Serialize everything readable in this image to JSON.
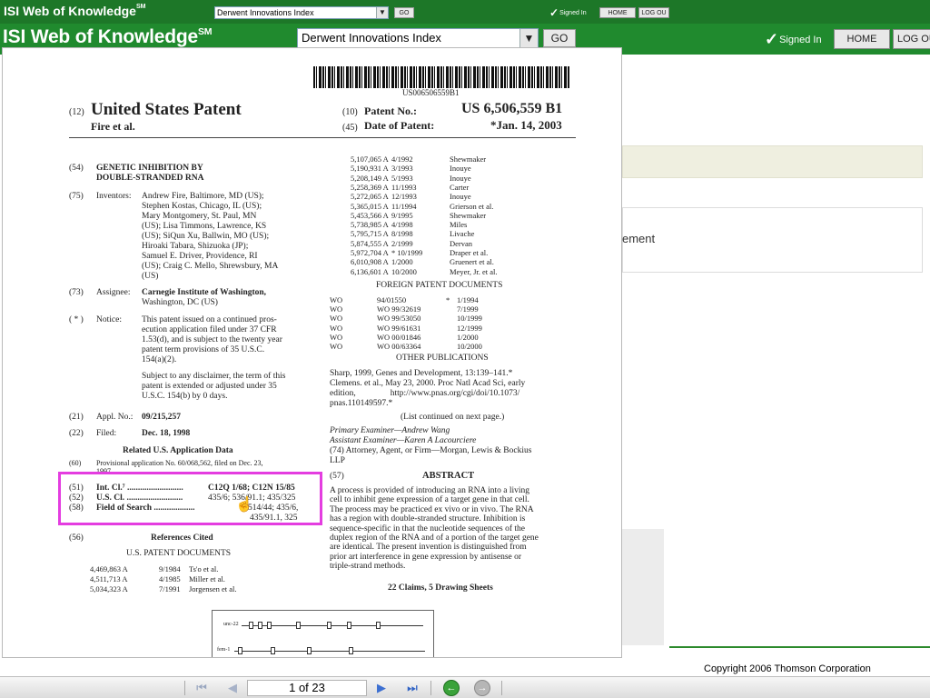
{
  "colors": {
    "brand_green": "#208a2e",
    "highlight": "#e43de0"
  },
  "header_small": {
    "brand": "ISI Web of Knowledge",
    "brand_mark": "SM",
    "database": "Derwent Innovations Index",
    "go": "GO",
    "signed_in": "Signed In",
    "home": "HOME",
    "logout": "LOG OU"
  },
  "header": {
    "brand": "ISI Web of Knowledge",
    "brand_mark": "SM",
    "database": "Derwent Innovations Index",
    "go": "GO",
    "signed_in": "Signed In",
    "home": "HOME",
    "logout": "LOG OU"
  },
  "background": {
    "partial_word": "ement",
    "copyright": "Copyright 2006 Thomson Corporation"
  },
  "patent": {
    "number_small": "US006506559B1",
    "code12": "(12)",
    "title": "United States Patent",
    "inventor_short": "Fire et al.",
    "code10": "(10)",
    "patent_no_label": "Patent No.:",
    "patent_no": "US 6,506,559 B1",
    "code45": "(45)",
    "date_label": "Date of Patent:",
    "date": "*Jan. 14, 2003",
    "code54": "(54)",
    "invention_title_1": "GENETIC INHIBITION BY",
    "invention_title_2": "DOUBLE-STRANDED RNA",
    "code75": "(75)",
    "inventors_label": "Inventors:",
    "inventors_lines": [
      "Andrew Fire, Baltimore, MD (US);",
      "Stephen Kostas, Chicago, IL (US);",
      "Mary Montgomery, St. Paul, MN",
      "(US); Lisa Timmons, Lawrence, KS",
      "(US); SiQun Xu, Ballwin, MO (US);",
      "Hiroaki Tabara, Shizuoka (JP);",
      "Samuel E. Driver, Providence, RI",
      "(US); Craig C. Mello, Shrewsbury, MA",
      "(US)"
    ],
    "code73": "(73)",
    "assignee_label": "Assignee:",
    "assignee_lines": [
      "Carnegie Institute of Washington,",
      "Washington, DC (US)"
    ],
    "code_notice": "( * )",
    "notice_label": "Notice:",
    "notice_lines": [
      "This patent issued on a continued pros-",
      "ecution application filed under 37 CFR",
      "1.53(d), and is subject to the twenty year",
      "patent term provisions of 35 U.S.C.",
      "154(a)(2)."
    ],
    "disclaimer_lines": [
      "Subject to any disclaimer, the term of this",
      "patent is extended or adjusted under 35",
      "U.S.C. 154(b) by 0 days."
    ],
    "code21": "(21)",
    "appl_label": "Appl. No.:",
    "appl_no": "09/215,257",
    "code22": "(22)",
    "filed_label": "Filed:",
    "filed": "Dec. 18, 1998",
    "related_heading": "Related U.S. Application Data",
    "code60": "(60)",
    "provisional_1": "Provisional application No. 60/068,562, filed on Dec. 23,",
    "provisional_2": "1997.",
    "class_rows": [
      {
        "code": "(51)",
        "label": "Int. Cl.⁷ ..........................",
        "value": "C12Q 1/68; C12N 15/85"
      },
      {
        "code": "(52)",
        "label": "U.S. Cl. ..........................",
        "value": "435/6; 536/91.1; 435/325"
      },
      {
        "code": "(58)",
        "label": "Field of Search ...................",
        "value": "514/44; 435/6,"
      }
    ],
    "class_cont": "435/91.1, 325",
    "code56": "(56)",
    "refs_heading": "References Cited",
    "us_docs_heading": "U.S. PATENT DOCUMENTS",
    "us_refs_left": [
      [
        "4,469,863 A",
        "9/1984",
        "Ts'o et al."
      ],
      [
        "4,511,713 A",
        "4/1985",
        "Miller et al."
      ],
      [
        "5,034,323 A",
        "7/1991",
        "Jorgensen et al."
      ]
    ],
    "us_refs_right": [
      [
        "5,107,065 A",
        "4/1992",
        "Shewmaker"
      ],
      [
        "5,190,931 A",
        "3/1993",
        "Inouye"
      ],
      [
        "5,208,149 A",
        "5/1993",
        "Inouye"
      ],
      [
        "5,258,369 A",
        "11/1993",
        "Carter"
      ],
      [
        "5,272,065 A",
        "12/1993",
        "Inouye"
      ],
      [
        "5,365,015 A",
        "11/1994",
        "Grierson et al."
      ],
      [
        "5,453,566 A",
        "9/1995",
        "Shewmaker"
      ],
      [
        "5,738,985 A",
        "4/1998",
        "Miles"
      ],
      [
        "5,795,715 A",
        "8/1998",
        "Livache"
      ],
      [
        "5,874,555 A",
        "2/1999",
        "Dervan"
      ],
      [
        "5,972,704 A",
        "* 10/1999",
        "Draper et al."
      ],
      [
        "6,010,908 A",
        "1/2000",
        "Gruenert et al."
      ],
      [
        "6,136,601 A",
        "10/2000",
        "Meyer, Jr. et al."
      ]
    ],
    "foreign_heading": "FOREIGN PATENT DOCUMENTS",
    "foreign_refs": [
      [
        "WO",
        "94/01550",
        "*",
        "1/1994"
      ],
      [
        "WO",
        "WO 99/32619",
        "",
        "7/1999"
      ],
      [
        "WO",
        "WO 99/53050",
        "",
        "10/1999"
      ],
      [
        "WO",
        "WO 99/61631",
        "",
        "12/1999"
      ],
      [
        "WO",
        "WO 00/01846",
        "",
        "1/2000"
      ],
      [
        "WO",
        "WO 00/63364",
        "",
        "10/2000"
      ]
    ],
    "other_heading": "OTHER PUBLICATIONS",
    "other_lines": [
      "Sharp, 1999, Genes and Development, 13:139–141.*",
      "Clemens. et al., May 23, 2000. Proc Natl Acad Sci, early",
      "edition,                http://www.pnas.org/cgi/doi/10.1073/",
      "pnas.110149597.*"
    ],
    "continued": "(List continued on next page.)",
    "examiner_lines": [
      "Primary Examiner—Andrew Wang",
      "Assistant Examiner—Karen A Lacourciere",
      "(74) Attorney, Agent, or Firm—Morgan, Lewis & Bockius",
      "LLP"
    ],
    "code57": "(57)",
    "abstract_heading": "ABSTRACT",
    "abstract_lines": [
      "A process is provided of introducing an RNA into a living",
      "cell to inhibit gene expression of a target gene in that cell.",
      "The process may be practiced ex vivo or in vivo. The RNA",
      "has a region with double-stranded structure. Inhibition is",
      "sequence-specific in that the nucleotide sequences of the",
      "duplex region of the RNA and of a portion of the target gene",
      "are identical. The present invention is distinguished from",
      "prior art interference in gene expression by antisense or",
      "triple-strand methods."
    ],
    "claims": "22 Claims, 5 Drawing Sheets",
    "diagram_labels": [
      "unc-22",
      "fem-1"
    ]
  },
  "viewer_toolbar": {
    "page": "1 of 23"
  }
}
